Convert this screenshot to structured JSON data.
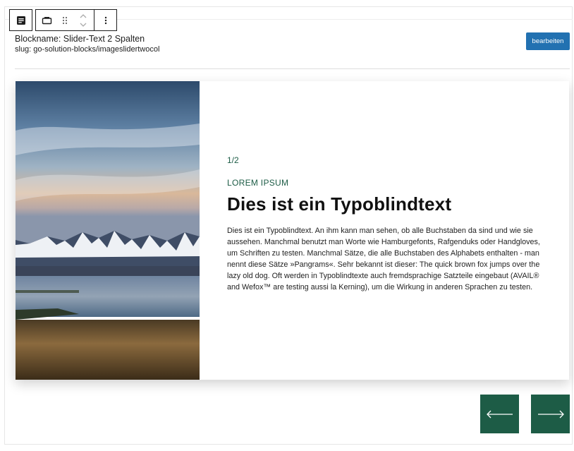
{
  "toolbar": {
    "block_icon": "post-content-icon",
    "transform_icon": "slider-block-icon",
    "drag_icon": "drag-handle-icon",
    "move_icon": "move-up-down-icon",
    "options_icon": "more-options-icon"
  },
  "block": {
    "name": "Blockname: Slider-Text 2 Spalten",
    "slug": "slug: go-solution-blocks/imageslidertwocol",
    "edit_label": "bearbeiten"
  },
  "slide": {
    "counter": "1/2",
    "kicker": "LOREM IPSUM",
    "heading": "Dies ist ein Typoblindtext",
    "body": "Dies ist ein Typoblindtext. An ihm kann man sehen, ob alle Buchstaben da sind und wie sie aussehen. Manchmal benutzt man Worte wie Hamburgefonts, Rafgenduks oder Handgloves, um Schriften zu testen. Manchmal Sätze, die alle Buchstaben des Alphabets enthalten - man nennt diese Sätze »Pangrams«. Sehr bekannt ist dieser: The quick brown fox jumps over the lazy old dog. Oft werden in Typoblindtexte auch fremdsprachige Satzteile eingebaut (AVAIL® and Wefox™ are testing aussi la Kerning), um die Wirkung in anderen Sprachen zu testen.",
    "image_subject": "mountain-lake-landscape"
  },
  "navigation": {
    "prev_icon": "arrow-left-icon",
    "next_icon": "arrow-right-icon"
  },
  "colors": {
    "accent": "#1d5c46",
    "button_blue": "#2271b1"
  }
}
